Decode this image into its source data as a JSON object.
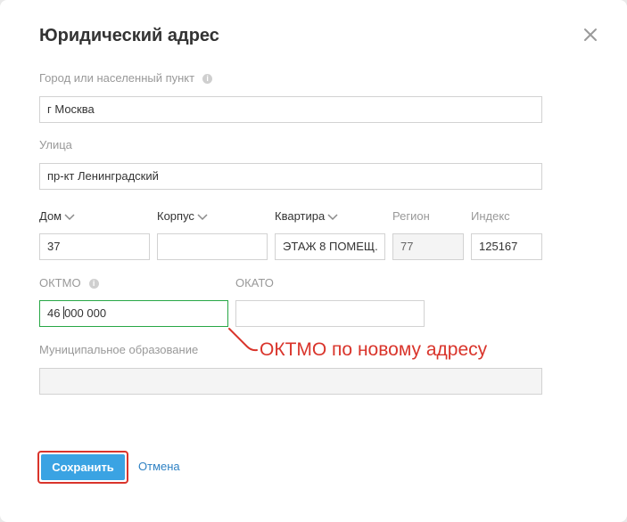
{
  "dialog": {
    "title": "Юридический адрес"
  },
  "fields": {
    "city": {
      "label": "Город или населенный пункт",
      "value": "г Москва"
    },
    "street": {
      "label": "Улица",
      "value": "пр-кт Ленинградский"
    },
    "house": {
      "label": "Дом",
      "value": "37"
    },
    "building": {
      "label": "Корпус",
      "value": ""
    },
    "apartment": {
      "label": "Квартира",
      "value": "ЭТАЖ 8 ПОМЕЩ."
    },
    "region": {
      "label": "Регион",
      "value": "77"
    },
    "index": {
      "label": "Индекс",
      "value": "125167"
    },
    "oktmo": {
      "label": "ОКТМО",
      "value_before_caret": "46 ",
      "value_after_caret": "000 000"
    },
    "okato": {
      "label": "ОКАТО",
      "value": ""
    },
    "municipal": {
      "label": "Муниципальное образование",
      "value": ""
    }
  },
  "annotation": {
    "text": "ОКТМО по новому адресу",
    "color": "#d9342b"
  },
  "actions": {
    "save_label": "Сохранить",
    "cancel_label": "Отмена"
  },
  "icons": {
    "close": "close-icon",
    "info": "info-icon",
    "chevron": "chevron-down-icon"
  },
  "colors": {
    "accent": "#3aa3e3",
    "link": "#2f82c4",
    "focus_border": "#27a745",
    "highlight": "#d9342b"
  }
}
